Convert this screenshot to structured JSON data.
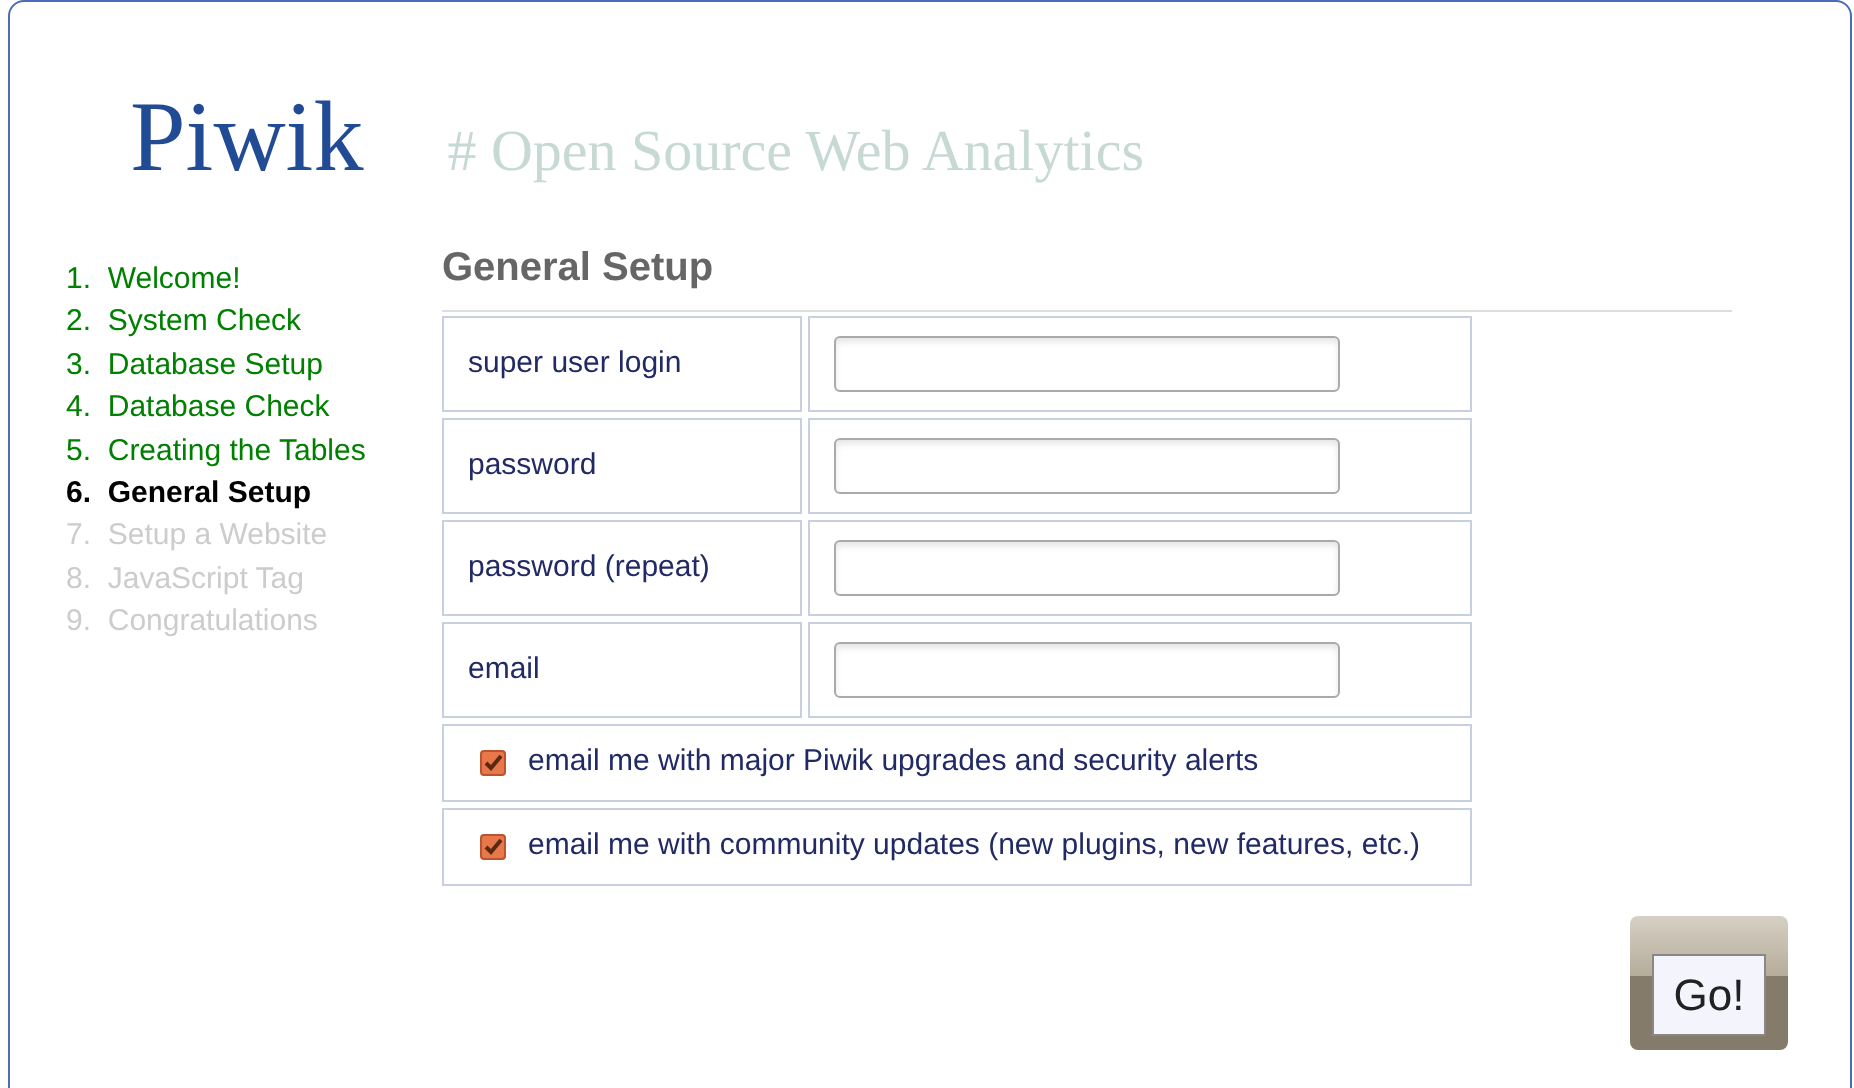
{
  "header": {
    "logo": "Piwik",
    "tagline": "# Open Source Web Analytics"
  },
  "steps": [
    {
      "number": "1.",
      "label": "Welcome!",
      "completed": true,
      "selected": false
    },
    {
      "number": "2.",
      "label": "System Check",
      "completed": true,
      "selected": false
    },
    {
      "number": "3.",
      "label": "Database Setup",
      "completed": true,
      "selected": false
    },
    {
      "number": "4.",
      "label": "Database Check",
      "completed": true,
      "selected": false
    },
    {
      "number": "5.",
      "label": "Creating the Tables",
      "completed": true,
      "selected": false
    },
    {
      "number": "6.",
      "label": "General Setup",
      "completed": false,
      "selected": true
    },
    {
      "number": "7.",
      "label": "Setup a Website",
      "completed": false,
      "selected": false
    },
    {
      "number": "8.",
      "label": "JavaScript Tag",
      "completed": false,
      "selected": false
    },
    {
      "number": "9.",
      "label": "Congratulations",
      "completed": false,
      "selected": false
    }
  ],
  "form": {
    "title": "General Setup",
    "fields": [
      {
        "label": "super user login"
      },
      {
        "label": "password"
      },
      {
        "label": "password (repeat)"
      },
      {
        "label": "email"
      }
    ],
    "options": [
      {
        "label": "email me with major Piwik upgrades and security alerts",
        "checked": true
      },
      {
        "label": "email me with community updates (new plugins, new features, etc.)",
        "checked": true
      }
    ],
    "submit": "Go!"
  }
}
